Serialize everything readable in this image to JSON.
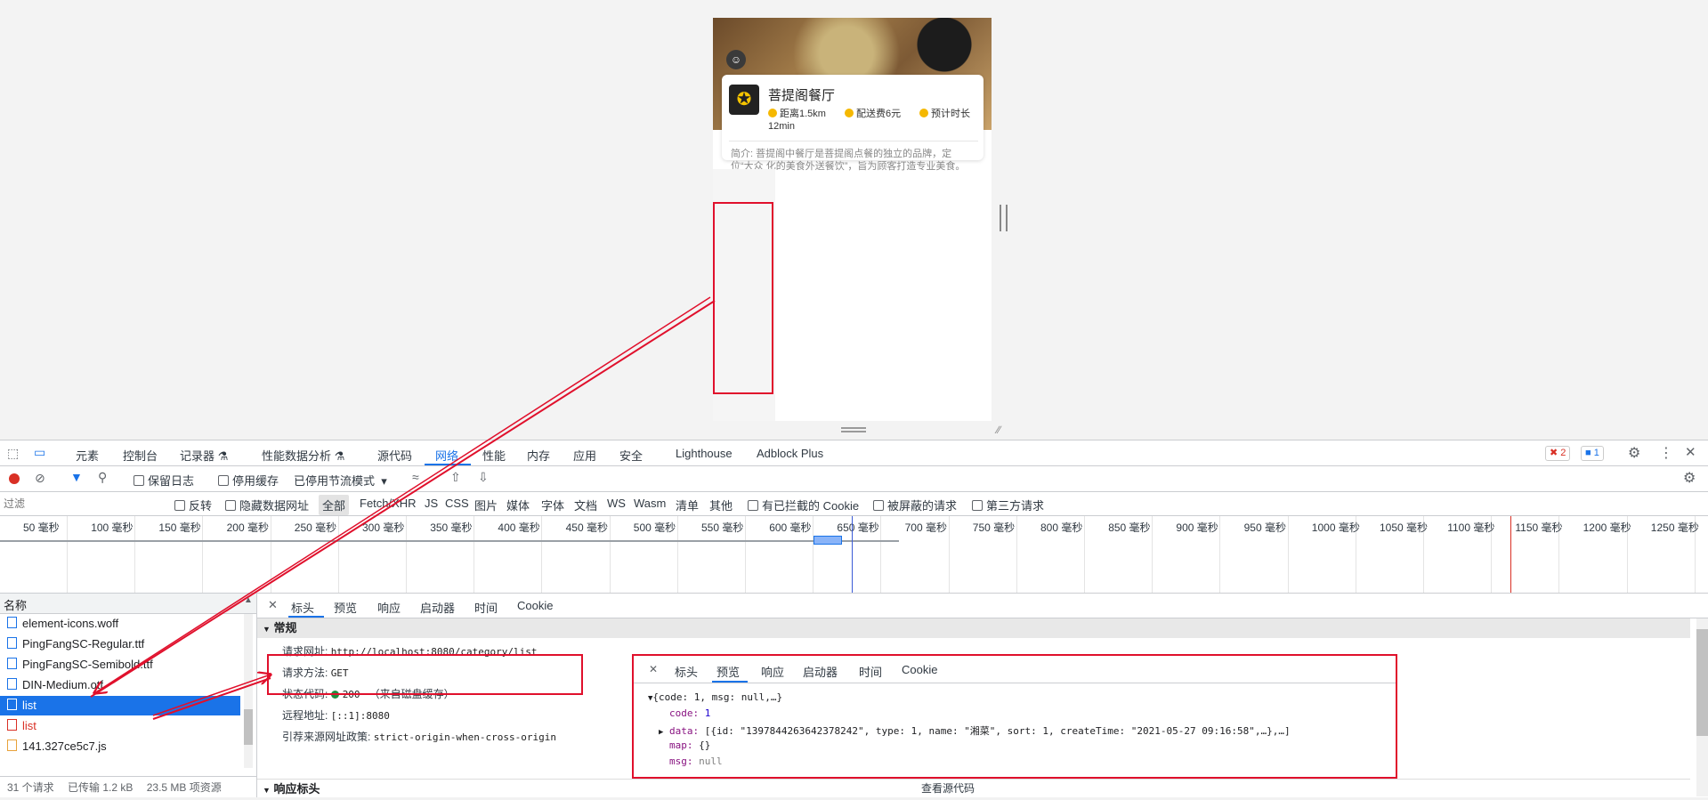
{
  "page": {
    "shop_name": "菩提阁餐厅",
    "distance": "距离1.5km",
    "delivery_fee": "配送费6元",
    "eta_label": "预计时长",
    "eta_value": "12min",
    "intro": "简介: 菩提阁中餐厅是菩提阁点餐的独立的品牌，定位“大众 化的美食外送餐饮”，旨为顾客打造专业美食。"
  },
  "devtools": {
    "tabs": [
      "元素",
      "控制台",
      "记录器 ⚗",
      "性能数据分析 ⚗",
      "源代码",
      "网络",
      "性能",
      "内存",
      "应用",
      "安全",
      "Lighthouse",
      "Adblock Plus"
    ],
    "error_count": "2",
    "message_count": "1",
    "toolbar": {
      "preserve_log": "保留日志",
      "disable_cache": "停用缓存",
      "throttle": "已停用节流模式"
    },
    "filter": {
      "placeholder": "过滤",
      "invert": "反转",
      "hide_data_urls": "隐藏数据网址",
      "types": [
        "全部",
        "Fetch/XHR",
        "JS",
        "CSS",
        "图片",
        "媒体",
        "字体",
        "文档",
        "WS",
        "Wasm",
        "清单",
        "其他"
      ],
      "blocked_cookies": "有已拦截的 Cookie",
      "blocked_requests": "被屏蔽的请求",
      "third_party": "第三方请求"
    },
    "timeline_ticks": [
      "50 毫秒",
      "100 毫秒",
      "150 毫秒",
      "200 毫秒",
      "250 毫秒",
      "300 毫秒",
      "350 毫秒",
      "400 毫秒",
      "450 毫秒",
      "500 毫秒",
      "550 毫秒",
      "600 毫秒",
      "650 毫秒",
      "700 毫秒",
      "750 毫秒",
      "800 毫秒",
      "850 毫秒",
      "900 毫秒",
      "950 毫秒",
      "1000 毫秒",
      "1050 毫秒",
      "1100 毫秒",
      "1150 毫秒",
      "1200 毫秒",
      "1250 毫秒"
    ],
    "requests_header": "名称",
    "requests": [
      {
        "name": "element-icons.woff",
        "state": "normal"
      },
      {
        "name": "PingFangSC-Regular.ttf",
        "state": "normal"
      },
      {
        "name": "PingFangSC-Semibold.ttf",
        "state": "normal"
      },
      {
        "name": "DIN-Medium.otf",
        "state": "normal"
      },
      {
        "name": "list",
        "state": "selected"
      },
      {
        "name": "list",
        "state": "error"
      },
      {
        "name": "141.327ce5c7.js",
        "state": "normal"
      }
    ],
    "status": {
      "requests": "31 个请求",
      "transferred": "已传输 1.2 kB",
      "resources": "23.5 MB 项资源"
    },
    "detail_tabs": [
      "标头",
      "预览",
      "响应",
      "启动器",
      "时间",
      "Cookie"
    ],
    "general_section": "常规",
    "general": {
      "url_label": "请求网址:",
      "url": "http://localhost:8080/category/list",
      "method_label": "请求方法:",
      "method": "GET",
      "status_label": "状态代码:",
      "status": "200",
      "status_note": "（来自磁盘缓存）",
      "remote_label": "远程地址:",
      "remote": "[::1]:8080",
      "referrer_label": "引荐来源网址政策:",
      "referrer": "strict-origin-when-cross-origin"
    },
    "response_headers_section": "响应标头",
    "view_source": "查看源代码"
  },
  "preview": {
    "tabs": [
      "标头",
      "预览",
      "响应",
      "启动器",
      "时间",
      "Cookie"
    ],
    "root": "{code: 1, msg: null,…}",
    "code_key": "code:",
    "code_val": "1",
    "data_key": "data:",
    "data_val": "[{id: \"1397844263642378242\", type: 1, name: \"湘菜\", sort: 1, createTime: \"2021-05-27 09:16:58\",…},…]",
    "map_key": "map:",
    "map_val": "{}",
    "msg_key": "msg:",
    "msg_val": "null"
  }
}
